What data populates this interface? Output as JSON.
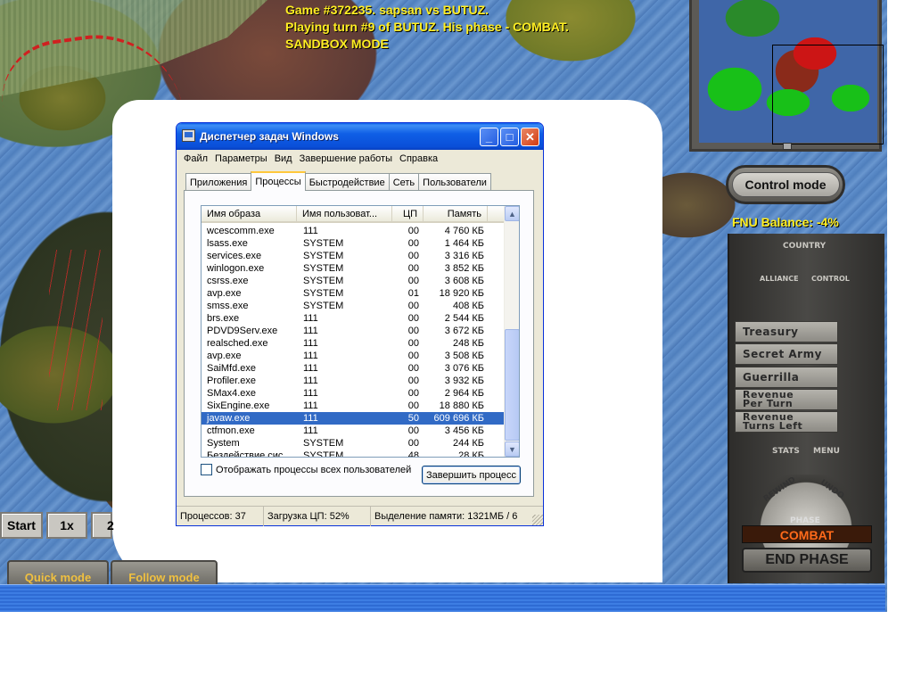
{
  "game": {
    "status_lines": [
      "Game #372235. sapsan vs BUTUZ.",
      "Playing turn #9 of BUTUZ. His phase - COMBAT.",
      "SANDBOX MODE"
    ],
    "bottom_controls": {
      "start_label": "Start",
      "speed_1x_label": "1x",
      "speed_2_label": "2",
      "quick_mode_label": "Quick mode",
      "follow_mode_label": "Follow mode"
    },
    "control_mode_label": "Control mode",
    "fnu_balance": "FNU Balance: -4%",
    "panel": {
      "country_label": "COUNTRY",
      "alliance_label": "ALLIANCE",
      "control_label": "CONTROL",
      "treasury_label": "Treasury",
      "secret_army_label": "Secret Army",
      "guerrilla_label": "Guerrilla",
      "revenue_per_turn": [
        "Revenue",
        "Per Turn"
      ],
      "revenue_turns_left": [
        "Revenue",
        "Turns Left"
      ],
      "stats_label": "STATS",
      "menu_label": "MENU",
      "rewind_label": "REWIND",
      "undo_label": "UNDO",
      "phase_label": "PHASE",
      "phase_value": "COMBAT",
      "end_phase_label": "END PHASE"
    }
  },
  "taskmgr": {
    "title": "Диспетчер задач Windows",
    "menu": [
      "Файл",
      "Параметры",
      "Вид",
      "Завершение работы",
      "Справка"
    ],
    "tabs": [
      "Приложения",
      "Процессы",
      "Быстродействие",
      "Сеть",
      "Пользователи"
    ],
    "active_tab": "Процессы",
    "columns": [
      "Имя образа",
      "Имя пользоват...",
      "ЦП",
      "Память"
    ],
    "rows": [
      {
        "name": "wcescomm.exe",
        "user": "111",
        "cpu": "00",
        "mem": "4 760 КБ"
      },
      {
        "name": "lsass.exe",
        "user": "SYSTEM",
        "cpu": "00",
        "mem": "1 464 КБ"
      },
      {
        "name": "services.exe",
        "user": "SYSTEM",
        "cpu": "00",
        "mem": "3 316 КБ"
      },
      {
        "name": "winlogon.exe",
        "user": "SYSTEM",
        "cpu": "00",
        "mem": "3 852 КБ"
      },
      {
        "name": "csrss.exe",
        "user": "SYSTEM",
        "cpu": "00",
        "mem": "3 608 КБ"
      },
      {
        "name": "avp.exe",
        "user": "SYSTEM",
        "cpu": "01",
        "mem": "18 920 КБ"
      },
      {
        "name": "smss.exe",
        "user": "SYSTEM",
        "cpu": "00",
        "mem": "408 КБ"
      },
      {
        "name": "brs.exe",
        "user": "111",
        "cpu": "00",
        "mem": "2 544 КБ"
      },
      {
        "name": "PDVD9Serv.exe",
        "user": "111",
        "cpu": "00",
        "mem": "3 672 КБ"
      },
      {
        "name": "realsched.exe",
        "user": "111",
        "cpu": "00",
        "mem": "248 КБ"
      },
      {
        "name": "avp.exe",
        "user": "111",
        "cpu": "00",
        "mem": "3 508 КБ"
      },
      {
        "name": "SaiMfd.exe",
        "user": "111",
        "cpu": "00",
        "mem": "3 076 КБ"
      },
      {
        "name": "Profiler.exe",
        "user": "111",
        "cpu": "00",
        "mem": "3 932 КБ"
      },
      {
        "name": "SMax4.exe",
        "user": "111",
        "cpu": "00",
        "mem": "2 964 КБ"
      },
      {
        "name": "SixEngine.exe",
        "user": "111",
        "cpu": "00",
        "mem": "18 880 КБ"
      },
      {
        "name": "javaw.exe",
        "user": "111",
        "cpu": "50",
        "mem": "609 696 КБ",
        "selected": true
      },
      {
        "name": "ctfmon.exe",
        "user": "111",
        "cpu": "00",
        "mem": "3 456 КБ"
      },
      {
        "name": "System",
        "user": "SYSTEM",
        "cpu": "00",
        "mem": "244 КБ"
      },
      {
        "name": "Бездействие сис...",
        "user": "SYSTEM",
        "cpu": "48",
        "mem": "28 КБ"
      }
    ],
    "show_all_users_label": "Отображать процессы всех пользователей",
    "show_all_users_checked": false,
    "end_process_label": "Завершить процесс",
    "status": {
      "processes": "Процессов: 37",
      "cpu_load": "Загрузка ЦП: 52%",
      "memory": "Выделение памяти: 1321МБ / 6"
    }
  },
  "colors": {
    "selection": "#316ac5",
    "game_text": "#ffee22",
    "phase_text": "#ff6a1a"
  }
}
